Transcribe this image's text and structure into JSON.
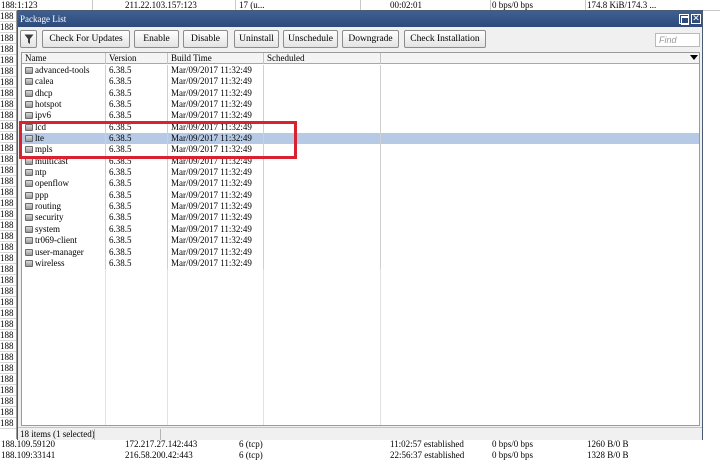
{
  "background": {
    "top_row": [
      "188:1:123",
      "211.22.103.157:123",
      "17 (u...",
      "00:02:01",
      "0 bps/0 bps",
      "174.8 KiB/174.3 ..."
    ],
    "left_column": [
      "188",
      "188",
      "188",
      "188",
      "188",
      "188",
      "188",
      "188",
      "188",
      "188",
      "188",
      "188",
      "188",
      "188",
      "188",
      "188",
      "188",
      "188",
      "188",
      "188",
      "188",
      "188",
      "188",
      "188",
      "188",
      "188",
      "188",
      "188",
      "188",
      "188",
      "188",
      "188",
      "188",
      "188",
      "188",
      "188",
      "188",
      "188"
    ],
    "bottom_rows": [
      [
        "188.109.59120",
        "172.217.27.142:443",
        "6 (tcp)",
        "11:02:57  established",
        "0 bps/0 bps",
        "1260 B/0 B"
      ],
      [
        "188.109:33141",
        "216.58.200.42:443",
        "6 (tcp)",
        "22:56:37  established",
        "0 bps/0 bps",
        "1328 B/0 B"
      ]
    ]
  },
  "window": {
    "title": "Package List",
    "toolbar": {
      "buttons": [
        "Check For Updates",
        "Enable",
        "Disable",
        "Uninstall",
        "Unschedule",
        "Downgrade",
        "Check Installation"
      ],
      "find_placeholder": "Find"
    },
    "columns": [
      "Name",
      "Version",
      "Build Time",
      "Scheduled"
    ],
    "rows": [
      {
        "name": "advanced-tools",
        "version": "6.38.5",
        "build_time": "Mar/09/2017 11:32:49",
        "scheduled": ""
      },
      {
        "name": "calea",
        "version": "6.38.5",
        "build_time": "Mar/09/2017 11:32:49",
        "scheduled": ""
      },
      {
        "name": "dhcp",
        "version": "6.38.5",
        "build_time": "Mar/09/2017 11:32:49",
        "scheduled": ""
      },
      {
        "name": "hotspot",
        "version": "6.38.5",
        "build_time": "Mar/09/2017 11:32:49",
        "scheduled": ""
      },
      {
        "name": "ipv6",
        "version": "6.38.5",
        "build_time": "Mar/09/2017 11:32:49",
        "scheduled": ""
      },
      {
        "name": "lcd",
        "version": "6.38.5",
        "build_time": "Mar/09/2017 11:32:49",
        "scheduled": ""
      },
      {
        "name": "lte",
        "version": "6.38.5",
        "build_time": "Mar/09/2017 11:32:49",
        "scheduled": "",
        "selected": true
      },
      {
        "name": "mpls",
        "version": "6.38.5",
        "build_time": "Mar/09/2017 11:32:49",
        "scheduled": ""
      },
      {
        "name": "multicast",
        "version": "6.38.5",
        "build_time": "Mar/09/2017 11:32:49",
        "scheduled": ""
      },
      {
        "name": "ntp",
        "version": "6.38.5",
        "build_time": "Mar/09/2017 11:32:49",
        "scheduled": ""
      },
      {
        "name": "openflow",
        "version": "6.38.5",
        "build_time": "Mar/09/2017 11:32:49",
        "scheduled": ""
      },
      {
        "name": "ppp",
        "version": "6.38.5",
        "build_time": "Mar/09/2017 11:32:49",
        "scheduled": ""
      },
      {
        "name": "routing",
        "version": "6.38.5",
        "build_time": "Mar/09/2017 11:32:49",
        "scheduled": ""
      },
      {
        "name": "security",
        "version": "6.38.5",
        "build_time": "Mar/09/2017 11:32:49",
        "scheduled": ""
      },
      {
        "name": "system",
        "version": "6.38.5",
        "build_time": "Mar/09/2017 11:32:49",
        "scheduled": ""
      },
      {
        "name": "tr069-client",
        "version": "6.38.5",
        "build_time": "Mar/09/2017 11:32:49",
        "scheduled": ""
      },
      {
        "name": "user-manager",
        "version": "6.38.5",
        "build_time": "Mar/09/2017 11:32:49",
        "scheduled": ""
      },
      {
        "name": "wireless",
        "version": "6.38.5",
        "build_time": "Mar/09/2017 11:32:49",
        "scheduled": ""
      }
    ],
    "status": "18 items (1 selected)"
  },
  "colors": {
    "titlebar": "#2d4a7a",
    "selection": "#b6cae6",
    "annotation": "#d6232f"
  }
}
